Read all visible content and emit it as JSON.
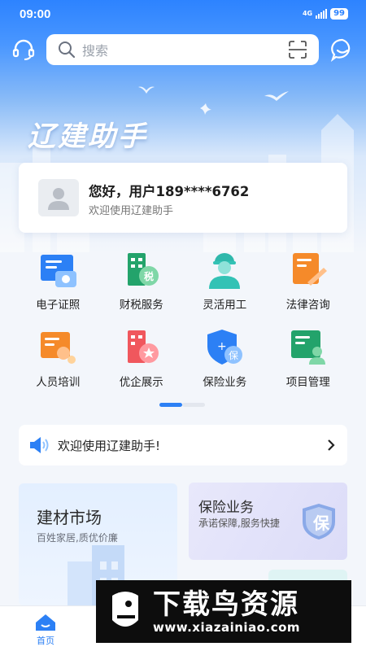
{
  "status_bar": {
    "time": "09:00",
    "network": "4G",
    "battery": "99"
  },
  "search": {
    "placeholder": "搜索"
  },
  "hero": {
    "title": "辽建助手"
  },
  "greeting": {
    "title": "您好，用户189****6762",
    "subtitle": "欢迎使用辽建助手"
  },
  "grid": {
    "items": [
      {
        "label": "电子证照",
        "icon": "certificate-icon"
      },
      {
        "label": "财税服务",
        "icon": "tax-building-icon"
      },
      {
        "label": "灵活用工",
        "icon": "worker-icon"
      },
      {
        "label": "法律咨询",
        "icon": "legal-document-icon"
      },
      {
        "label": "人员培训",
        "icon": "training-icon"
      },
      {
        "label": "优企展示",
        "icon": "enterprise-star-icon"
      },
      {
        "label": "保险业务",
        "icon": "insurance-shield-icon"
      },
      {
        "label": "项目管理",
        "icon": "project-icon"
      }
    ]
  },
  "notice": {
    "text": "欢迎使用辽建助手!"
  },
  "cards": {
    "market": {
      "title": "建材市场",
      "subtitle": "百姓家居,质优价廉"
    },
    "insurance": {
      "title": "保险业务",
      "subtitle": "承诺保障,服务快捷",
      "badge": "保"
    }
  },
  "bottom_nav": {
    "home_label": "首页"
  },
  "watermark": {
    "text_cn": "下载鸟资源",
    "url": "www.xiazainiao.com"
  },
  "colors": {
    "primary": "#2c80f5",
    "orange": "#f58a2a",
    "green": "#23a36b",
    "teal": "#33c2b5",
    "red": "#f0575d"
  }
}
